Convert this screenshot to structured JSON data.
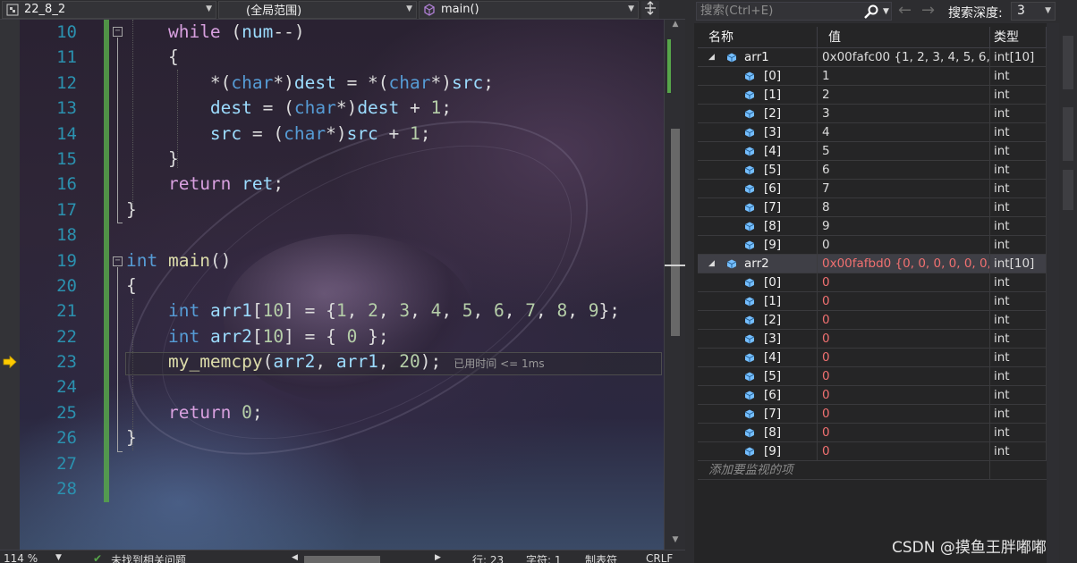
{
  "nav": {
    "project": "22_8_2",
    "scope": "(全局范围)",
    "function": "main()"
  },
  "code": {
    "line_numbers": [
      "10",
      "11",
      "12",
      "13",
      "14",
      "15",
      "16",
      "17",
      "18",
      "19",
      "20",
      "21",
      "22",
      "23",
      "24",
      "25",
      "26",
      "27",
      "28"
    ],
    "elapsed_text": "已用时间 <= 1ms",
    "current_line": "23"
  },
  "status": {
    "zoom": "114 %",
    "issues": "未找到相关问题",
    "line": "行: 23",
    "char": "字符: 1",
    "indent": "制表符",
    "eol": "CRLF"
  },
  "watch": {
    "search_placeholder": "搜索(Ctrl+E)",
    "depth_label": "搜索深度:",
    "depth_value": "3",
    "columns": {
      "name": "名称",
      "value": "值",
      "type": "类型"
    },
    "arr1": {
      "name": "arr1",
      "value": "0x00fafc00 {1, 2, 3, 4, 5, 6, ...",
      "type": "int[10]",
      "items": [
        {
          "name": "[0]",
          "value": "1",
          "type": "int"
        },
        {
          "name": "[1]",
          "value": "2",
          "type": "int"
        },
        {
          "name": "[2]",
          "value": "3",
          "type": "int"
        },
        {
          "name": "[3]",
          "value": "4",
          "type": "int"
        },
        {
          "name": "[4]",
          "value": "5",
          "type": "int"
        },
        {
          "name": "[5]",
          "value": "6",
          "type": "int"
        },
        {
          "name": "[6]",
          "value": "7",
          "type": "int"
        },
        {
          "name": "[7]",
          "value": "8",
          "type": "int"
        },
        {
          "name": "[8]",
          "value": "9",
          "type": "int"
        },
        {
          "name": "[9]",
          "value": "0",
          "type": "int"
        }
      ]
    },
    "arr2": {
      "name": "arr2",
      "value": "0x00fafbd0 {0, 0, 0, 0, 0, 0, ...",
      "type": "int[10]",
      "items": [
        {
          "name": "[0]",
          "value": "0",
          "type": "int"
        },
        {
          "name": "[1]",
          "value": "0",
          "type": "int"
        },
        {
          "name": "[2]",
          "value": "0",
          "type": "int"
        },
        {
          "name": "[3]",
          "value": "0",
          "type": "int"
        },
        {
          "name": "[4]",
          "value": "0",
          "type": "int"
        },
        {
          "name": "[5]",
          "value": "0",
          "type": "int"
        },
        {
          "name": "[6]",
          "value": "0",
          "type": "int"
        },
        {
          "name": "[7]",
          "value": "0",
          "type": "int"
        },
        {
          "name": "[8]",
          "value": "0",
          "type": "int"
        },
        {
          "name": "[9]",
          "value": "0",
          "type": "int"
        }
      ]
    },
    "add_item": "添加要监视的项"
  },
  "watermark": "CSDN @摸鱼王胖嘟嘟",
  "colors": {
    "keyword": "#d8a0df",
    "type": "#569cd6",
    "function": "#dcdcaa",
    "variable": "#9cdcfe",
    "number": "#b5cea8",
    "line_number": "#2b91af",
    "changed_value": "#f07070",
    "change_bar": "#57a64a"
  }
}
